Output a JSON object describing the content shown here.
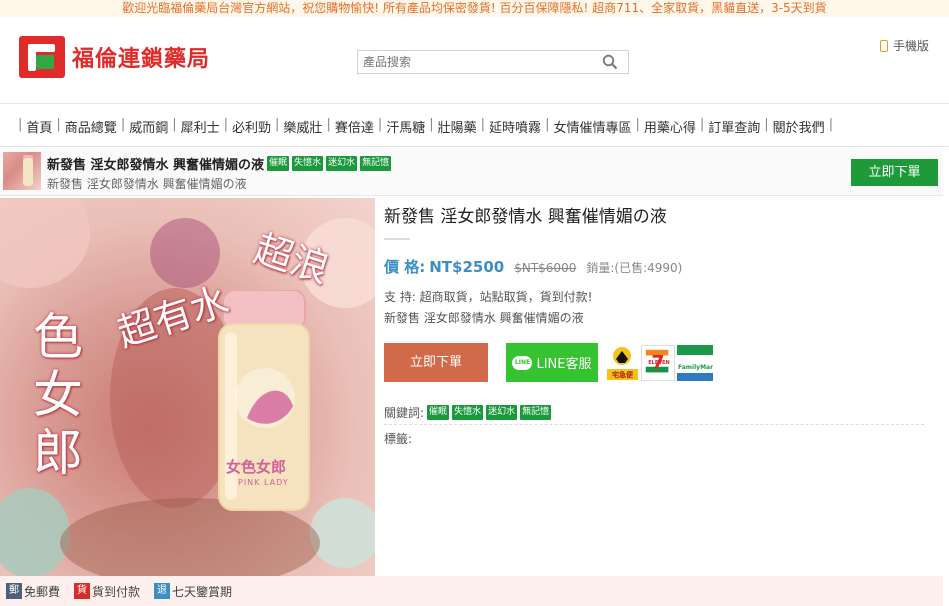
{
  "topbar": {
    "text": "歡迎光臨福倫藥局台灣官方網站，祝您購物愉快! 所有產品均保密發貨! 百分百保障隱私! 超商711、全家取貨，黑貓直送，3-5天到貨"
  },
  "header": {
    "logo_text": "福倫連鎖藥局",
    "search_placeholder": "產品搜索",
    "mobile_label": "手機版"
  },
  "nav": {
    "items": [
      "首頁",
      "商品總覽",
      "威而鋼",
      "犀利士",
      "必利勁",
      "樂威壯",
      "賽倍達",
      "汗馬糖",
      "壯陽藥",
      "延時噴霧",
      "女情催情專區",
      "用藥心得",
      "訂單查詢",
      "關於我們"
    ]
  },
  "product_bar": {
    "title": "新發售 淫女郎發情水 興奮催情媚の液",
    "subtitle": "新發售 淫女郎發情水 興奮催情媚の液",
    "tags": [
      "催眠",
      "失憶水",
      "迷幻水",
      "無記憶"
    ],
    "order_button": "立即下單"
  },
  "main_image": {
    "text_1": "超有水",
    "text_2": "超浪",
    "side_text": "色女郎",
    "bottle_label": "女色女郎",
    "bottle_sub": "PINK LADY"
  },
  "product": {
    "title": "新發售 淫女郎發情水 興奮催情媚の液",
    "price_label": "價 格:",
    "price": "NT$2500",
    "old_price": "$NT$6000",
    "sold": "銷量:(已售:4990)",
    "support": "支  持:  超商取貨，站點取貨，貨到付款!",
    "description": "新發售 淫女郎發情水 興奮催情媚の液",
    "order_button": "立即下單",
    "line_button": "LINE客服",
    "line_icon_text": "LINE",
    "logo_cat_text": "宅急便",
    "logo_711_text": "ELEVEN",
    "logo_fm_text": "FamilyMar",
    "keywords_label": "關鍵詞:",
    "keywords": [
      "催眠",
      "失憶水",
      "迷幻水",
      "無記憶"
    ],
    "tags_label": "標籤:"
  },
  "bottom": {
    "items": [
      {
        "icon": "郵",
        "label": "免郵費",
        "color": "#4f5f78"
      },
      {
        "icon": "貨",
        "label": "貨到付款",
        "color": "#d92b2b"
      },
      {
        "icon": "退",
        "label": "七天鑒賞期",
        "color": "#3c8ec6"
      }
    ]
  },
  "colors": {
    "brand_red": "#e02b2b",
    "brand_green": "#1f9a3a",
    "price_blue": "#3c8ec6",
    "order_orange": "#d06a4b",
    "line_green": "#35c331",
    "topbar_orange": "#e4702a"
  }
}
